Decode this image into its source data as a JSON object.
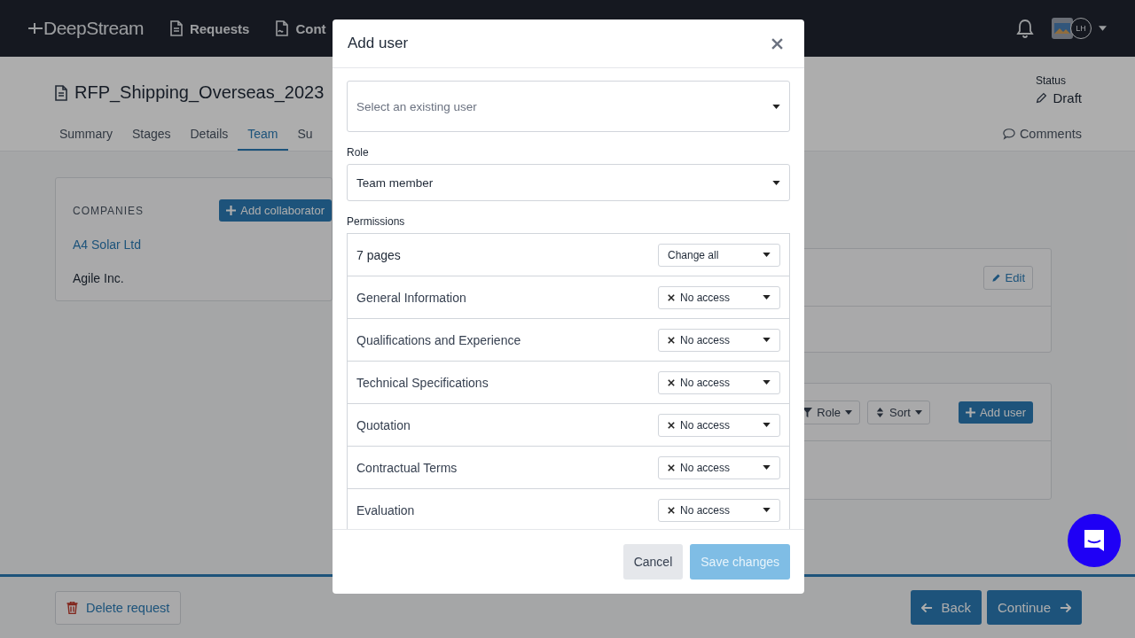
{
  "nav": {
    "logo": "DeepStream",
    "items": [
      {
        "label": "Requests",
        "kind": "document"
      },
      {
        "label": "Cont",
        "kind": "contract"
      }
    ],
    "avatar_initials": "LH"
  },
  "request": {
    "title": "RFP_Shipping_Overseas_2023",
    "status_label": "Status",
    "status": "Draft"
  },
  "tabs": [
    {
      "label": "Summary",
      "selected": false
    },
    {
      "label": "Stages",
      "selected": false
    },
    {
      "label": "Details",
      "selected": false
    },
    {
      "label": "Team",
      "selected": true
    },
    {
      "label": "Su",
      "selected": false
    }
  ],
  "comments": "Comments",
  "companies": {
    "heading": "COMPANIES",
    "add_button": "Add collaborator",
    "items": [
      {
        "name": "A4 Solar Ltd",
        "selected": true
      },
      {
        "name": "Agile Inc.",
        "selected": false
      }
    ]
  },
  "panel": {
    "edit_button": "Edit"
  },
  "users": {
    "filters": [
      {
        "label": "Role",
        "kind": "filter"
      },
      {
        "label": "Sort",
        "kind": "sort"
      }
    ],
    "add_button": "Add user"
  },
  "footer": {
    "delete_button": "Delete request",
    "back_button": "Back",
    "continue_button": "Continue"
  },
  "modal": {
    "title": "Add user",
    "user_select": {
      "placeholder": "Select an existing user"
    },
    "role_label": "Role",
    "role": "Team member",
    "permissions_label": "Permissions",
    "summary": "7 pages",
    "change_all": "Change all",
    "pages": [
      {
        "name": "General Information",
        "access": "No access"
      },
      {
        "name": "Qualifications and Experience",
        "access": "No access"
      },
      {
        "name": "Technical Specifications",
        "access": "No access"
      },
      {
        "name": "Quotation",
        "access": "No access"
      },
      {
        "name": "Contractual Terms",
        "access": "No access"
      },
      {
        "name": "Evaluation",
        "access": "No access"
      }
    ],
    "cancel": "Cancel",
    "save": "Save changes",
    "save_disabled": true
  }
}
